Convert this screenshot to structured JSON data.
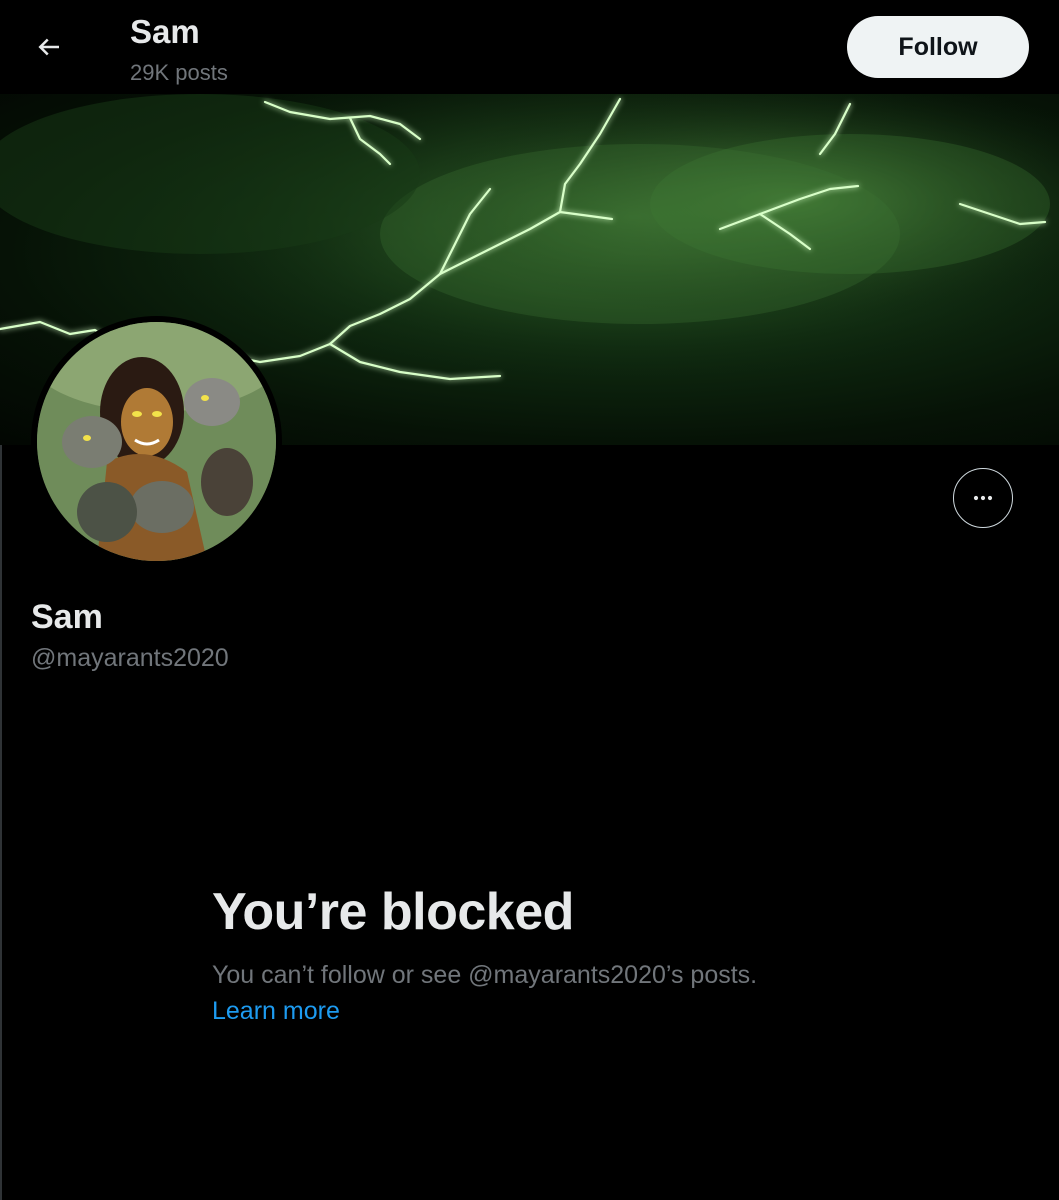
{
  "header": {
    "name": "Sam",
    "posts": "29K posts",
    "follow_label": "Follow"
  },
  "profile": {
    "name": "Sam",
    "handle": "@mayarants2020"
  },
  "blocked": {
    "title": "You’re blocked",
    "description": "You can’t follow or see @mayarants2020’s posts.",
    "learn_more": "Learn more"
  },
  "icons": {
    "back": "arrow-left-icon",
    "more": "more-horizontal-icon"
  },
  "colors": {
    "background": "#000000",
    "follow_bg": "#eff3f4",
    "link": "#1d9bf0",
    "secondary_text": "#71767b",
    "lightning": "#c8ffb0"
  }
}
